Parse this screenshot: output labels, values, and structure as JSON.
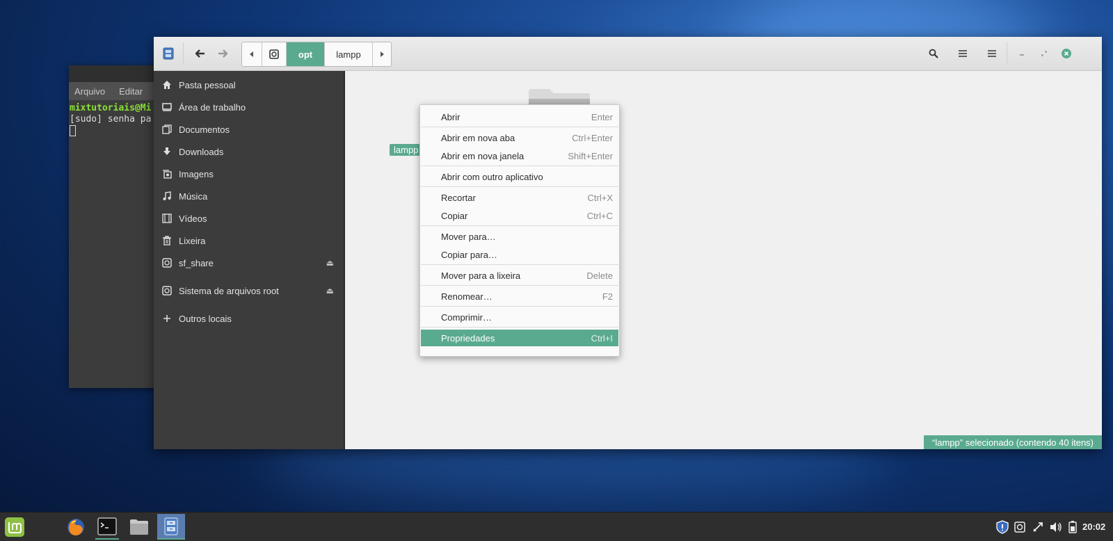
{
  "terminal": {
    "menu": [
      "Arquivo",
      "Editar"
    ],
    "prompt": "mixtutoriais@Mi",
    "line2": "[sudo] senha pa"
  },
  "fm": {
    "breadcrumb": [
      "opt",
      "lampp"
    ],
    "sidebar": [
      {
        "label": "Pasta pessoal",
        "icon": "home-icon"
      },
      {
        "label": "Área de trabalho",
        "icon": "desktop-icon"
      },
      {
        "label": "Documentos",
        "icon": "documents-icon"
      },
      {
        "label": "Downloads",
        "icon": "download-icon"
      },
      {
        "label": "Imagens",
        "icon": "pictures-icon"
      },
      {
        "label": "Música",
        "icon": "music-icon"
      },
      {
        "label": "Vídeos",
        "icon": "video-icon"
      },
      {
        "label": "Lixeira",
        "icon": "trash-icon"
      },
      {
        "label": "sf_share",
        "icon": "drive-icon"
      },
      {
        "label": "Sistema de arquivos root",
        "icon": "drive-icon"
      },
      {
        "label": "Outros locais",
        "icon": "plus-icon"
      }
    ],
    "folder_label": "lampp",
    "status": "“lampp” selecionado  (contendo 40 itens)"
  },
  "context_menu": [
    {
      "label": "Abrir",
      "shortcut": "Enter"
    },
    {
      "label": "Abrir em nova aba",
      "shortcut": "Ctrl+Enter"
    },
    {
      "label": "Abrir em nova janela",
      "shortcut": "Shift+Enter"
    },
    {
      "label": "Abrir com outro aplicativo",
      "shortcut": ""
    },
    {
      "label": "Recortar",
      "shortcut": "Ctrl+X"
    },
    {
      "label": "Copiar",
      "shortcut": "Ctrl+C"
    },
    {
      "label": "Mover para…",
      "shortcut": ""
    },
    {
      "label": "Copiar para…",
      "shortcut": ""
    },
    {
      "label": "Mover para a lixeira",
      "shortcut": "Delete"
    },
    {
      "label": "Renomear…",
      "shortcut": "F2"
    },
    {
      "label": "Comprimir…",
      "shortcut": ""
    },
    {
      "label": "Propriedades",
      "shortcut": "Ctrl+I"
    }
  ],
  "taskbar": {
    "clock": "20:02"
  },
  "colors": {
    "accent": "#5aaa8f",
    "sidebar_bg": "#3c3c3c"
  }
}
